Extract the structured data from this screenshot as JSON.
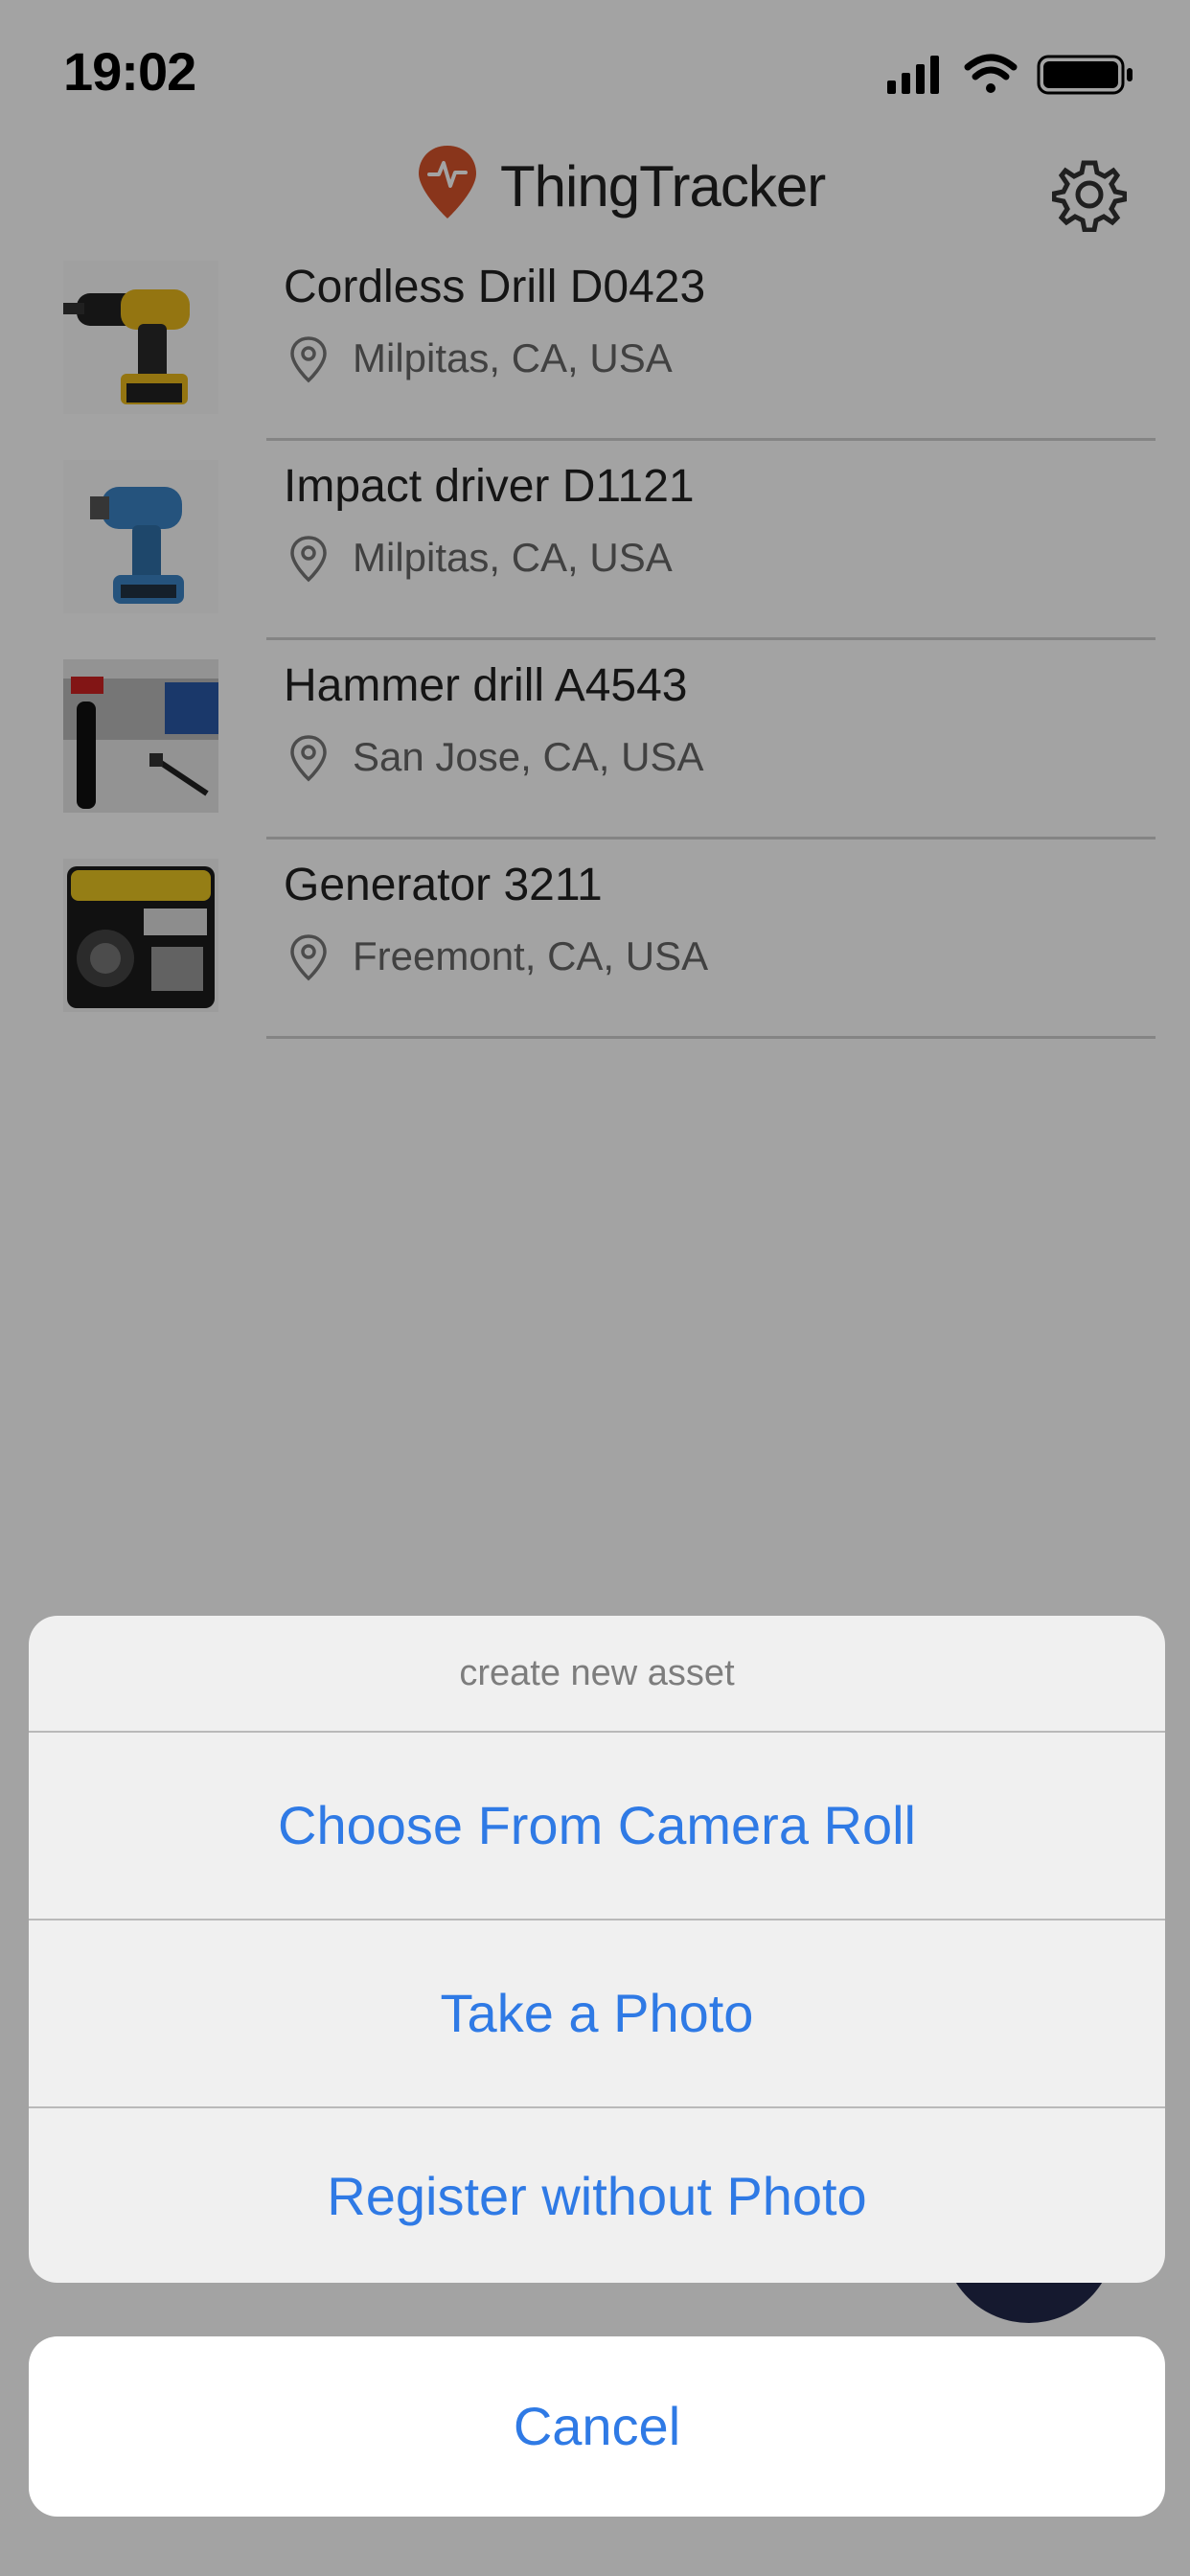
{
  "status_bar": {
    "time": "19:02"
  },
  "header": {
    "app_title": "ThingTracker",
    "brand_color": "#d6542b"
  },
  "assets": [
    {
      "name": "Cordless Drill D0423",
      "location": "Milpitas, CA, USA",
      "thumbnail": "cordless-drill"
    },
    {
      "name": "Impact driver D1121",
      "location": "Milpitas, CA, USA",
      "thumbnail": "impact-driver"
    },
    {
      "name": "Hammer drill A4543",
      "location": "San Jose, CA, USA",
      "thumbnail": "hammer-drill"
    },
    {
      "name": "Generator 3211",
      "location": "Freemont, CA, USA",
      "thumbnail": "generator"
    }
  ],
  "action_sheet": {
    "title": "create new asset",
    "options": [
      "Choose From Camera Roll",
      "Take a Photo",
      "Register without Photo"
    ],
    "cancel_label": "Cancel",
    "accent_color": "#2f7ae5"
  }
}
